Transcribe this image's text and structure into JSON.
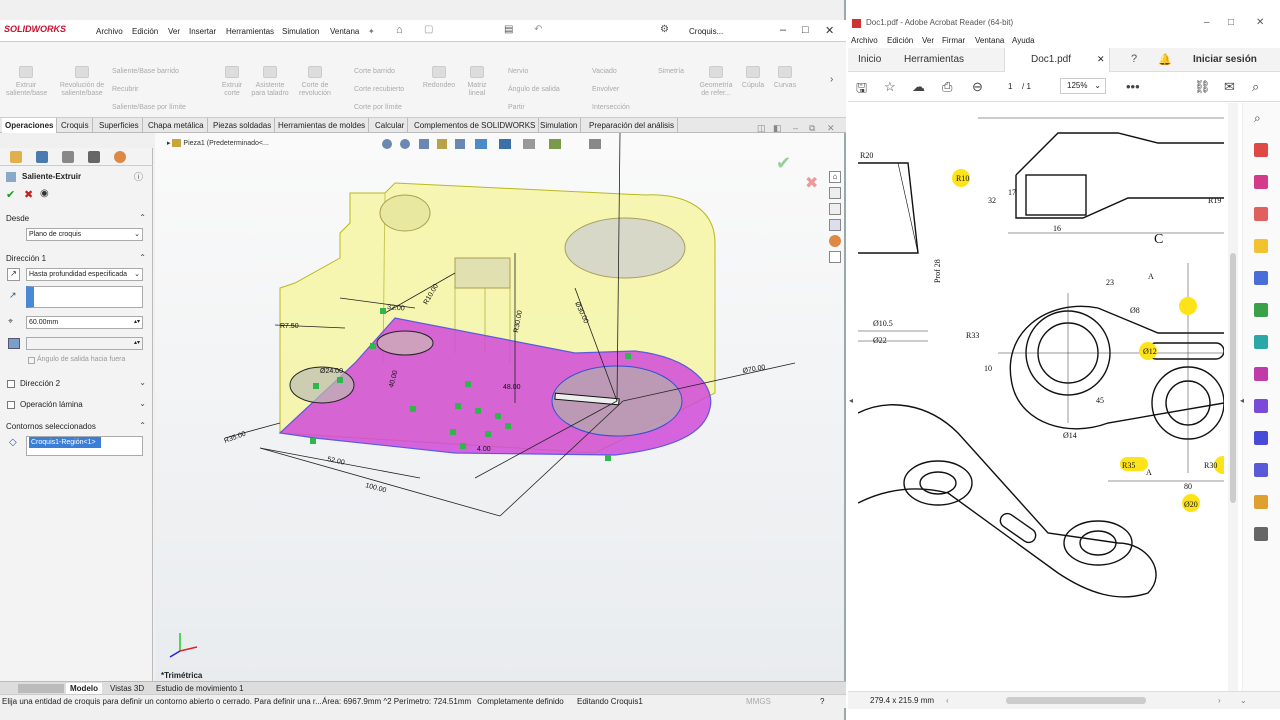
{
  "solidworks": {
    "logo": "SOLIDWORKS",
    "menu": [
      "Archivo",
      "Edición",
      "Ver",
      "Insertar",
      "Herramientas",
      "Simulation",
      "Ventana"
    ],
    "search_label": "Croquis...",
    "commands": [
      {
        "label": "Extruir saliente/base"
      },
      {
        "label": "Revolución de saliente/base"
      },
      {
        "label": "Saliente/Base barrido"
      },
      {
        "label": "Recubrir"
      },
      {
        "label": "Saliente/Base por límite"
      },
      {
        "label": "Extruir corte"
      },
      {
        "label": "Asistente para taladro"
      },
      {
        "label": "Corte de revolución"
      },
      {
        "label": "Corte barrido"
      },
      {
        "label": "Corte recubierto"
      },
      {
        "label": "Corte por límite"
      },
      {
        "label": "Redondeo"
      },
      {
        "label": "Matriz lineal"
      },
      {
        "label": "Nervio"
      },
      {
        "label": "Ángulo de salida"
      },
      {
        "label": "Partir"
      },
      {
        "label": "Vaciado"
      },
      {
        "label": "Envolver"
      },
      {
        "label": "Intersección"
      },
      {
        "label": "Simetría"
      },
      {
        "label": "Geometría de refer..."
      },
      {
        "label": "Cúpula"
      },
      {
        "label": "Curvas"
      }
    ],
    "tabs": [
      "Operaciones",
      "Croquis",
      "Superficies",
      "Chapa metálica",
      "Piezas soldadas",
      "Herramientas de moldes",
      "Calcular",
      "Complementos de SOLIDWORKS",
      "Simulation",
      "Preparación del análisis"
    ],
    "property_manager": {
      "title": "Saliente-Extruir",
      "desde_label": "Desde",
      "desde_value": "Plano de croquis",
      "dir1_label": "Dirección 1",
      "dir1_type": "Hasta profundidad especificada",
      "depth": "60.00mm",
      "draft_label": "Ángulo de salida hacia fuera",
      "dir2_label": "Dirección 2",
      "thin_label": "Operación lámina",
      "contours_label": "Contornos seleccionados",
      "contour_item": "Croquis1-Región<1>"
    },
    "tree_label": "Pieza1  (Predeterminado<...",
    "view_label": "*Trimétrica",
    "dims": [
      "R7.50",
      "32.00",
      "R10.00",
      "Ø30.00",
      "R30.00",
      "Ø24.00",
      "40.00",
      "Ø70.00",
      "R35.00",
      "52.00",
      "100.00",
      "48.00",
      "4.00"
    ],
    "bottom_tabs": [
      "Modelo",
      "Vistas 3D",
      "Estudio de movimiento 1"
    ],
    "status": {
      "hint": "Elija una entidad de croquis para definir un contorno abierto o cerrado. Para definir una r...",
      "area": "Área: 6967.9mm ^2 Perímetro: 724.51mm",
      "defined": "Completamente definido",
      "editing": "Editando Croquis1",
      "units": "MMGS"
    }
  },
  "acrobat": {
    "title": "Doc1.pdf - Adobe Acrobat Reader (64-bit)",
    "menu": [
      "Archivo",
      "Edición",
      "Ver",
      "Firmar",
      "Ventana",
      "Ayuda"
    ],
    "tabs": {
      "home": "Inicio",
      "tools": "Herramientas",
      "doc": "Doc1.pdf"
    },
    "signin": "Iniciar sesión",
    "page": "1",
    "pages": "/ 1",
    "zoom": "125%",
    "page_size": "279.4 x 215.9 mm",
    "drawing_labels": [
      "R20",
      "R10",
      "32",
      "17",
      "16",
      "R19",
      "C",
      "Prof 28",
      "Ø10.5",
      "Ø22",
      "A",
      "23",
      "Ø8",
      "R33",
      "10",
      "Ø12",
      "45",
      "Ø14",
      "R35",
      "80",
      "R30",
      "Ø20",
      "A"
    ]
  }
}
